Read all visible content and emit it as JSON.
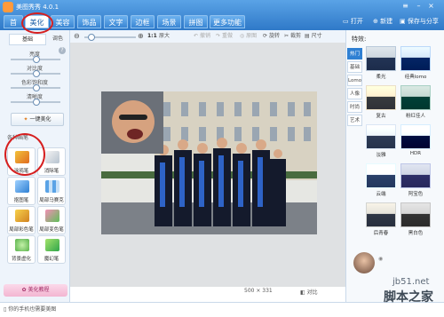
{
  "app": {
    "title": "美图秀秀 4.0.1"
  },
  "tabs": [
    {
      "label": "美化",
      "active": true
    },
    {
      "label": "美容",
      "active": false
    },
    {
      "label": "饰品",
      "active": false
    },
    {
      "label": "文字",
      "active": false
    },
    {
      "label": "边框",
      "active": false
    },
    {
      "label": "场景",
      "active": false
    },
    {
      "label": "拼图",
      "active": false
    },
    {
      "label": "更多功能 ▾",
      "active": false
    }
  ],
  "top_right": {
    "open": "打开",
    "new": "新建",
    "save": "保存与分享"
  },
  "toolbar": {
    "zoom_ratio": "1:1",
    "original_size": "原大",
    "undo": "撤销",
    "redo": "重做",
    "original": "原图",
    "rotate": "旋转",
    "crop": "裁剪",
    "size": "尺寸"
  },
  "left_panel": {
    "tab_basic": "基础",
    "tab_color": "调色",
    "sliders": [
      {
        "label": "亮度",
        "value": 0.5
      },
      {
        "label": "对比度",
        "value": 0.5
      },
      {
        "label": "色彩饱和度",
        "value": 0.5
      },
      {
        "label": "清晰度",
        "value": 0.5
      }
    ],
    "one_key": "一键美化",
    "section_label": "各种画笔",
    "tools": [
      {
        "label": "涂鸦笔"
      },
      {
        "label": "消除笔"
      },
      {
        "label": "抠图笔"
      },
      {
        "label": "局部马赛克"
      },
      {
        "label": "局部彩色笔"
      },
      {
        "label": "局部变色笔"
      },
      {
        "label": "背景虚化"
      },
      {
        "label": "魔幻笔"
      }
    ],
    "tutorial": "美化教程"
  },
  "right_panel": {
    "title": "特效:",
    "categories": [
      {
        "label": "热门",
        "active": true
      },
      {
        "label": "基础",
        "active": false
      },
      {
        "label": "Lomo",
        "active": false
      },
      {
        "label": "人像",
        "active": false
      },
      {
        "label": "时尚",
        "active": false
      },
      {
        "label": "艺术",
        "active": false
      }
    ],
    "effects": [
      {
        "label": "柔光"
      },
      {
        "label": "经典lomo"
      },
      {
        "label": "复古"
      },
      {
        "label": "粉红佳人"
      },
      {
        "label": "淡雅"
      },
      {
        "label": "HDR"
      },
      {
        "label": "云端"
      },
      {
        "label": "阿宝色"
      },
      {
        "label": "后青春"
      },
      {
        "label": "黑白色"
      }
    ]
  },
  "canvas": {
    "dimensions": "500 × 331",
    "compare": "对比"
  },
  "status": {
    "left_text": "你的手机也需要美图",
    "watermark_1": "jb51.net",
    "watermark_2": "脚本之家"
  },
  "colors": {
    "accent": "#2f80d3",
    "annotation": "#d61f1f"
  },
  "icons": [
    "zoom-out-icon",
    "zoom-in-icon",
    "undo-icon",
    "redo-icon",
    "rotate-icon",
    "crop-icon",
    "resize-icon",
    "help-icon"
  ]
}
